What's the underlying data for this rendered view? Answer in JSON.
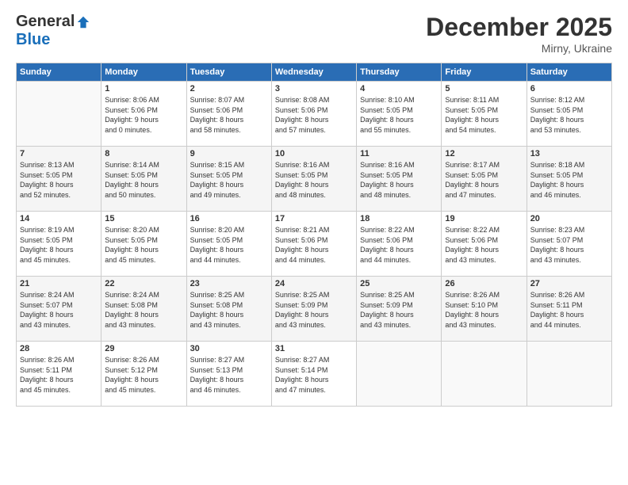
{
  "logo": {
    "general": "General",
    "blue": "Blue"
  },
  "header": {
    "month": "December 2025",
    "location": "Mirny, Ukraine"
  },
  "weekdays": [
    "Sunday",
    "Monday",
    "Tuesday",
    "Wednesday",
    "Thursday",
    "Friday",
    "Saturday"
  ],
  "weeks": [
    [
      {
        "day": "",
        "info": ""
      },
      {
        "day": "1",
        "info": "Sunrise: 8:06 AM\nSunset: 5:06 PM\nDaylight: 9 hours\nand 0 minutes."
      },
      {
        "day": "2",
        "info": "Sunrise: 8:07 AM\nSunset: 5:06 PM\nDaylight: 8 hours\nand 58 minutes."
      },
      {
        "day": "3",
        "info": "Sunrise: 8:08 AM\nSunset: 5:06 PM\nDaylight: 8 hours\nand 57 minutes."
      },
      {
        "day": "4",
        "info": "Sunrise: 8:10 AM\nSunset: 5:05 PM\nDaylight: 8 hours\nand 55 minutes."
      },
      {
        "day": "5",
        "info": "Sunrise: 8:11 AM\nSunset: 5:05 PM\nDaylight: 8 hours\nand 54 minutes."
      },
      {
        "day": "6",
        "info": "Sunrise: 8:12 AM\nSunset: 5:05 PM\nDaylight: 8 hours\nand 53 minutes."
      }
    ],
    [
      {
        "day": "7",
        "info": "Sunrise: 8:13 AM\nSunset: 5:05 PM\nDaylight: 8 hours\nand 52 minutes."
      },
      {
        "day": "8",
        "info": "Sunrise: 8:14 AM\nSunset: 5:05 PM\nDaylight: 8 hours\nand 50 minutes."
      },
      {
        "day": "9",
        "info": "Sunrise: 8:15 AM\nSunset: 5:05 PM\nDaylight: 8 hours\nand 49 minutes."
      },
      {
        "day": "10",
        "info": "Sunrise: 8:16 AM\nSunset: 5:05 PM\nDaylight: 8 hours\nand 48 minutes."
      },
      {
        "day": "11",
        "info": "Sunrise: 8:16 AM\nSunset: 5:05 PM\nDaylight: 8 hours\nand 48 minutes."
      },
      {
        "day": "12",
        "info": "Sunrise: 8:17 AM\nSunset: 5:05 PM\nDaylight: 8 hours\nand 47 minutes."
      },
      {
        "day": "13",
        "info": "Sunrise: 8:18 AM\nSunset: 5:05 PM\nDaylight: 8 hours\nand 46 minutes."
      }
    ],
    [
      {
        "day": "14",
        "info": "Sunrise: 8:19 AM\nSunset: 5:05 PM\nDaylight: 8 hours\nand 45 minutes."
      },
      {
        "day": "15",
        "info": "Sunrise: 8:20 AM\nSunset: 5:05 PM\nDaylight: 8 hours\nand 45 minutes."
      },
      {
        "day": "16",
        "info": "Sunrise: 8:20 AM\nSunset: 5:05 PM\nDaylight: 8 hours\nand 44 minutes."
      },
      {
        "day": "17",
        "info": "Sunrise: 8:21 AM\nSunset: 5:06 PM\nDaylight: 8 hours\nand 44 minutes."
      },
      {
        "day": "18",
        "info": "Sunrise: 8:22 AM\nSunset: 5:06 PM\nDaylight: 8 hours\nand 44 minutes."
      },
      {
        "day": "19",
        "info": "Sunrise: 8:22 AM\nSunset: 5:06 PM\nDaylight: 8 hours\nand 43 minutes."
      },
      {
        "day": "20",
        "info": "Sunrise: 8:23 AM\nSunset: 5:07 PM\nDaylight: 8 hours\nand 43 minutes."
      }
    ],
    [
      {
        "day": "21",
        "info": "Sunrise: 8:24 AM\nSunset: 5:07 PM\nDaylight: 8 hours\nand 43 minutes."
      },
      {
        "day": "22",
        "info": "Sunrise: 8:24 AM\nSunset: 5:08 PM\nDaylight: 8 hours\nand 43 minutes."
      },
      {
        "day": "23",
        "info": "Sunrise: 8:25 AM\nSunset: 5:08 PM\nDaylight: 8 hours\nand 43 minutes."
      },
      {
        "day": "24",
        "info": "Sunrise: 8:25 AM\nSunset: 5:09 PM\nDaylight: 8 hours\nand 43 minutes."
      },
      {
        "day": "25",
        "info": "Sunrise: 8:25 AM\nSunset: 5:09 PM\nDaylight: 8 hours\nand 43 minutes."
      },
      {
        "day": "26",
        "info": "Sunrise: 8:26 AM\nSunset: 5:10 PM\nDaylight: 8 hours\nand 43 minutes."
      },
      {
        "day": "27",
        "info": "Sunrise: 8:26 AM\nSunset: 5:11 PM\nDaylight: 8 hours\nand 44 minutes."
      }
    ],
    [
      {
        "day": "28",
        "info": "Sunrise: 8:26 AM\nSunset: 5:11 PM\nDaylight: 8 hours\nand 45 minutes."
      },
      {
        "day": "29",
        "info": "Sunrise: 8:26 AM\nSunset: 5:12 PM\nDaylight: 8 hours\nand 45 minutes."
      },
      {
        "day": "30",
        "info": "Sunrise: 8:27 AM\nSunset: 5:13 PM\nDaylight: 8 hours\nand 46 minutes."
      },
      {
        "day": "31",
        "info": "Sunrise: 8:27 AM\nSunset: 5:14 PM\nDaylight: 8 hours\nand 47 minutes."
      },
      {
        "day": "",
        "info": ""
      },
      {
        "day": "",
        "info": ""
      },
      {
        "day": "",
        "info": ""
      }
    ]
  ]
}
